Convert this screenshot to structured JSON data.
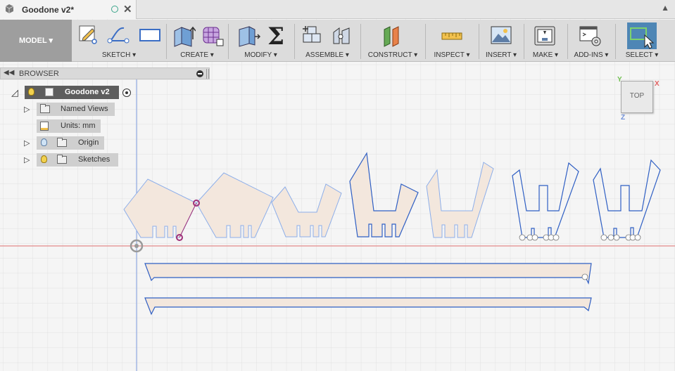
{
  "document": {
    "title": "Goodone v2*"
  },
  "toolbar": {
    "workspace": "MODEL ▾",
    "groups": {
      "sketch": "SKETCH ▾",
      "create": "CREATE ▾",
      "modify": "MODIFY ▾",
      "assemble": "ASSEMBLE ▾",
      "construct": "CONSTRUCT ▾",
      "inspect": "INSPECT ▾",
      "insert": "INSERT ▾",
      "make": "MAKE ▾",
      "addins": "ADD-INS ▾",
      "select": "SELECT ▾"
    }
  },
  "browser": {
    "label": "BROWSER",
    "root": "Goodone v2",
    "items": [
      {
        "label": "Named Views"
      },
      {
        "label": "Units: mm"
      },
      {
        "label": "Origin"
      },
      {
        "label": "Sketches"
      }
    ]
  },
  "viewcube": {
    "face": "TOP",
    "axes": {
      "x": "X",
      "y": "Y",
      "z": "Z"
    }
  },
  "colors": {
    "sketch_line": "#2f5fc4",
    "sketch_line_light": "#7da3e3",
    "profile_fill": "#f3e7dd",
    "grid": "#e3e3e3",
    "axis_red": "#e06060",
    "axis_blue": "#6f8fd8",
    "constraint": "#a0307a",
    "select_active": "#4e86b5"
  }
}
